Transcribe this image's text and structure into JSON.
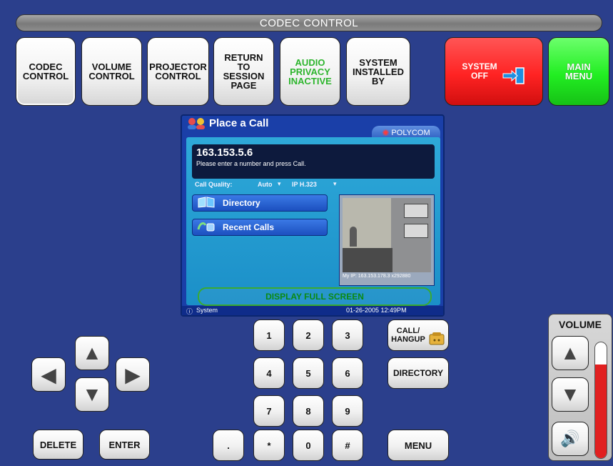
{
  "titlebar": {
    "title": "CODEC CONTROL"
  },
  "top_buttons": [
    {
      "label": "CODEC\nCONTROL"
    },
    {
      "label": "VOLUME\nCONTROL"
    },
    {
      "label": "PROJECTOR\nCONTROL"
    },
    {
      "label": "RETURN\nTO\nSESSION\nPAGE"
    },
    {
      "label": "AUDIO\nPRIVACY\nINACTIVE"
    },
    {
      "label": "SYSTEM\nINSTALLED\nBY"
    },
    {
      "label": "SYSTEM\nOFF"
    },
    {
      "label": "MAIN\nMENU"
    }
  ],
  "colors": {
    "background": "#2b3f8c",
    "audio_privacy_text": "#2db52d",
    "system_off": "#ff2323",
    "main_menu": "#22ee22"
  },
  "polycom": {
    "title": "Place a Call",
    "brand": "POLYCOM",
    "number": "163.153.5.6",
    "hint": "Please enter a number and press Call.",
    "call_quality_label": "Call Quality:",
    "quality_auto": "Auto",
    "quality_protocol": "IP H.323",
    "directory": "Directory",
    "recent_calls": "Recent Calls",
    "my_ip": "My IP: 163.153.178.3 x292880",
    "full_screen": "DISPLAY FULL SCREEN",
    "status_system": "System",
    "datetime": "01-26-2005  12:49PM"
  },
  "keypad": {
    "keys": [
      "1",
      "2",
      "3",
      "4",
      "5",
      "6",
      "7",
      "8",
      "9",
      "*",
      "0",
      "#"
    ],
    "dot": "."
  },
  "side_buttons": {
    "call_hangup": "CALL/\nHANGUP",
    "directory": "DIRECTORY",
    "menu": "MENU",
    "delete": "DELETE",
    "enter": "ENTER"
  },
  "volume": {
    "label": "VOLUME",
    "level_percent": 81
  }
}
